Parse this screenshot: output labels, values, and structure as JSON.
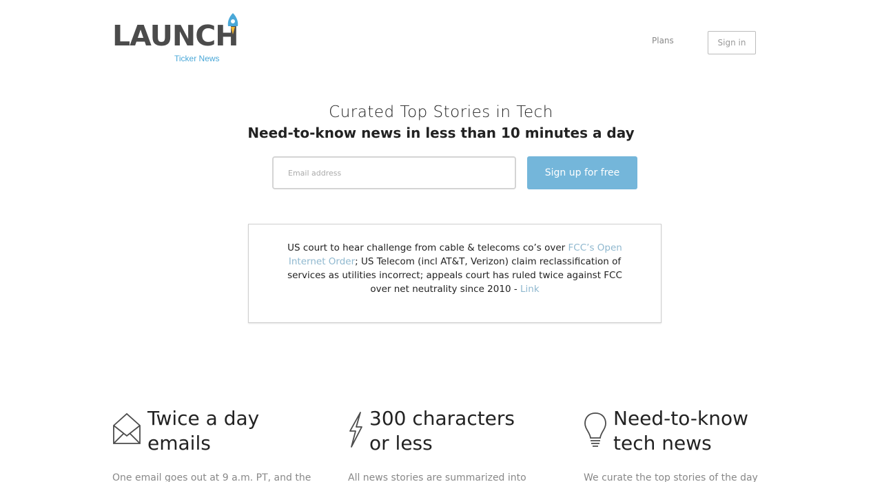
{
  "brand": {
    "logo_word": "LAUNCH",
    "logo_sub": "Ticker News",
    "logo_color": "#4b4b4b",
    "accent_color": "#4aa8d8"
  },
  "nav": {
    "plans_label": "Plans",
    "signin_label": "Sign in"
  },
  "hero": {
    "title": "Curated Top Stories in Tech",
    "subtitle": "Need-to-know news in less than 10 minutes a day",
    "email_placeholder": "Email address",
    "signup_label": "Sign up for free",
    "signup_color": "#74b6da"
  },
  "story": {
    "text_before": "US court to hear challenge from cable & telecoms co’s over ",
    "link1_text": "FCC’s Open Internet Order",
    "text_after": "; US Telecom (incl AT&T, Verizon) claim reclassification of services as utilities incorrect; appeals court has ruled twice against FCC over net neutrality since 2010 - ",
    "link2_text": "Link",
    "link_color": "#8fb8cf"
  },
  "features": [
    {
      "icon": "envelope-icon",
      "title": "Twice a day\nemails",
      "desc": "One email goes out at 9 a.m. PT, and the"
    },
    {
      "icon": "lightning-icon",
      "title": "300 characters\nor less",
      "desc": "All news stories are summarized into"
    },
    {
      "icon": "lightbulb-icon",
      "title": "Need-to-know\ntech news",
      "desc": "We curate the top stories of the day"
    }
  ]
}
